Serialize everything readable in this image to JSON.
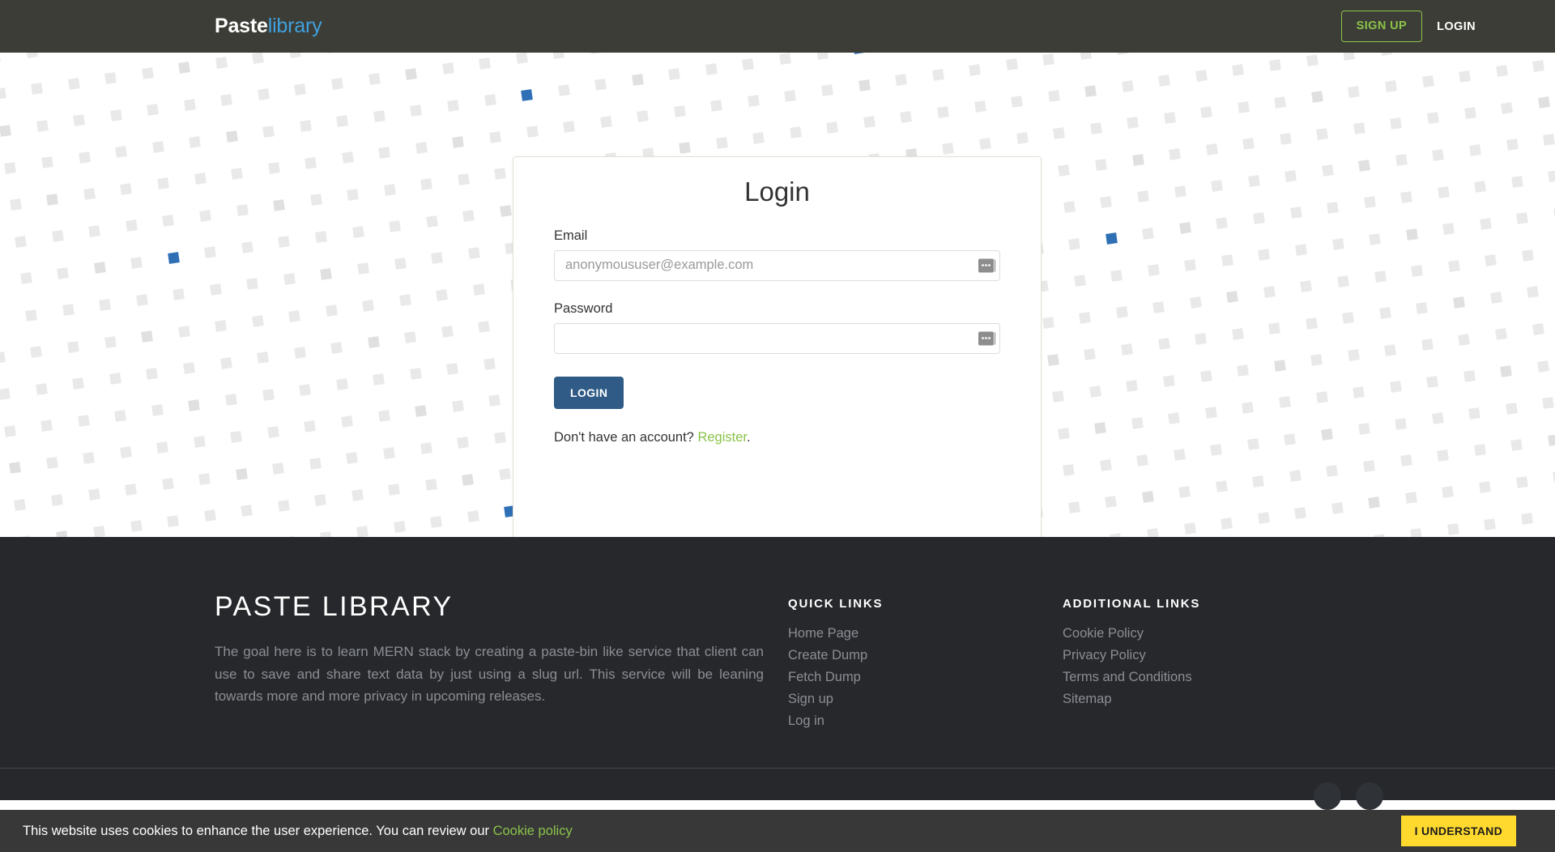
{
  "navbar": {
    "brand_primary": "Paste",
    "brand_secondary": "library",
    "signup_label": "SIGN UP",
    "login_label": "LOGIN",
    "background_color": "#3d3d37",
    "accent_green": "#8bc34a",
    "brand_blue": "#3fa2e0"
  },
  "login_card": {
    "title": "Login",
    "email_label": "Email",
    "email_placeholder": "anonymoususer@example.com",
    "email_value": "",
    "password_label": "Password",
    "password_placeholder": "",
    "password_value": "",
    "submit_label": "LOGIN",
    "submit_color": "#2f5b86",
    "register_prompt": "Don't have an account? ",
    "register_link": "Register",
    "register_suffix": "."
  },
  "footer": {
    "about": {
      "heading": "PASTE LIBRARY",
      "description": "The goal here is to learn MERN stack by creating a paste-bin like service that client can use to save and share text data by just using a slug url. This service will be leaning towards more and more privacy in upcoming releases."
    },
    "quick_links": {
      "heading": "QUICK LINKS",
      "items": [
        {
          "label": "Home Page"
        },
        {
          "label": "Create Dump"
        },
        {
          "label": "Fetch Dump"
        },
        {
          "label": "Sign up"
        },
        {
          "label": "Log in"
        }
      ]
    },
    "additional_links": {
      "heading": "ADDITIONAL LINKS",
      "items": [
        {
          "label": "Cookie Policy"
        },
        {
          "label": "Privacy Policy"
        },
        {
          "label": "Terms and Conditions"
        },
        {
          "label": "Sitemap"
        }
      ]
    },
    "background_color": "#26282c"
  },
  "cookie_banner": {
    "message": "This website uses cookies to enhance the user experience. You can review our ",
    "link_label": "Cookie policy",
    "button_label": "I UNDERSTAND",
    "button_color": "#ffd92e",
    "background_color": "#383838"
  }
}
